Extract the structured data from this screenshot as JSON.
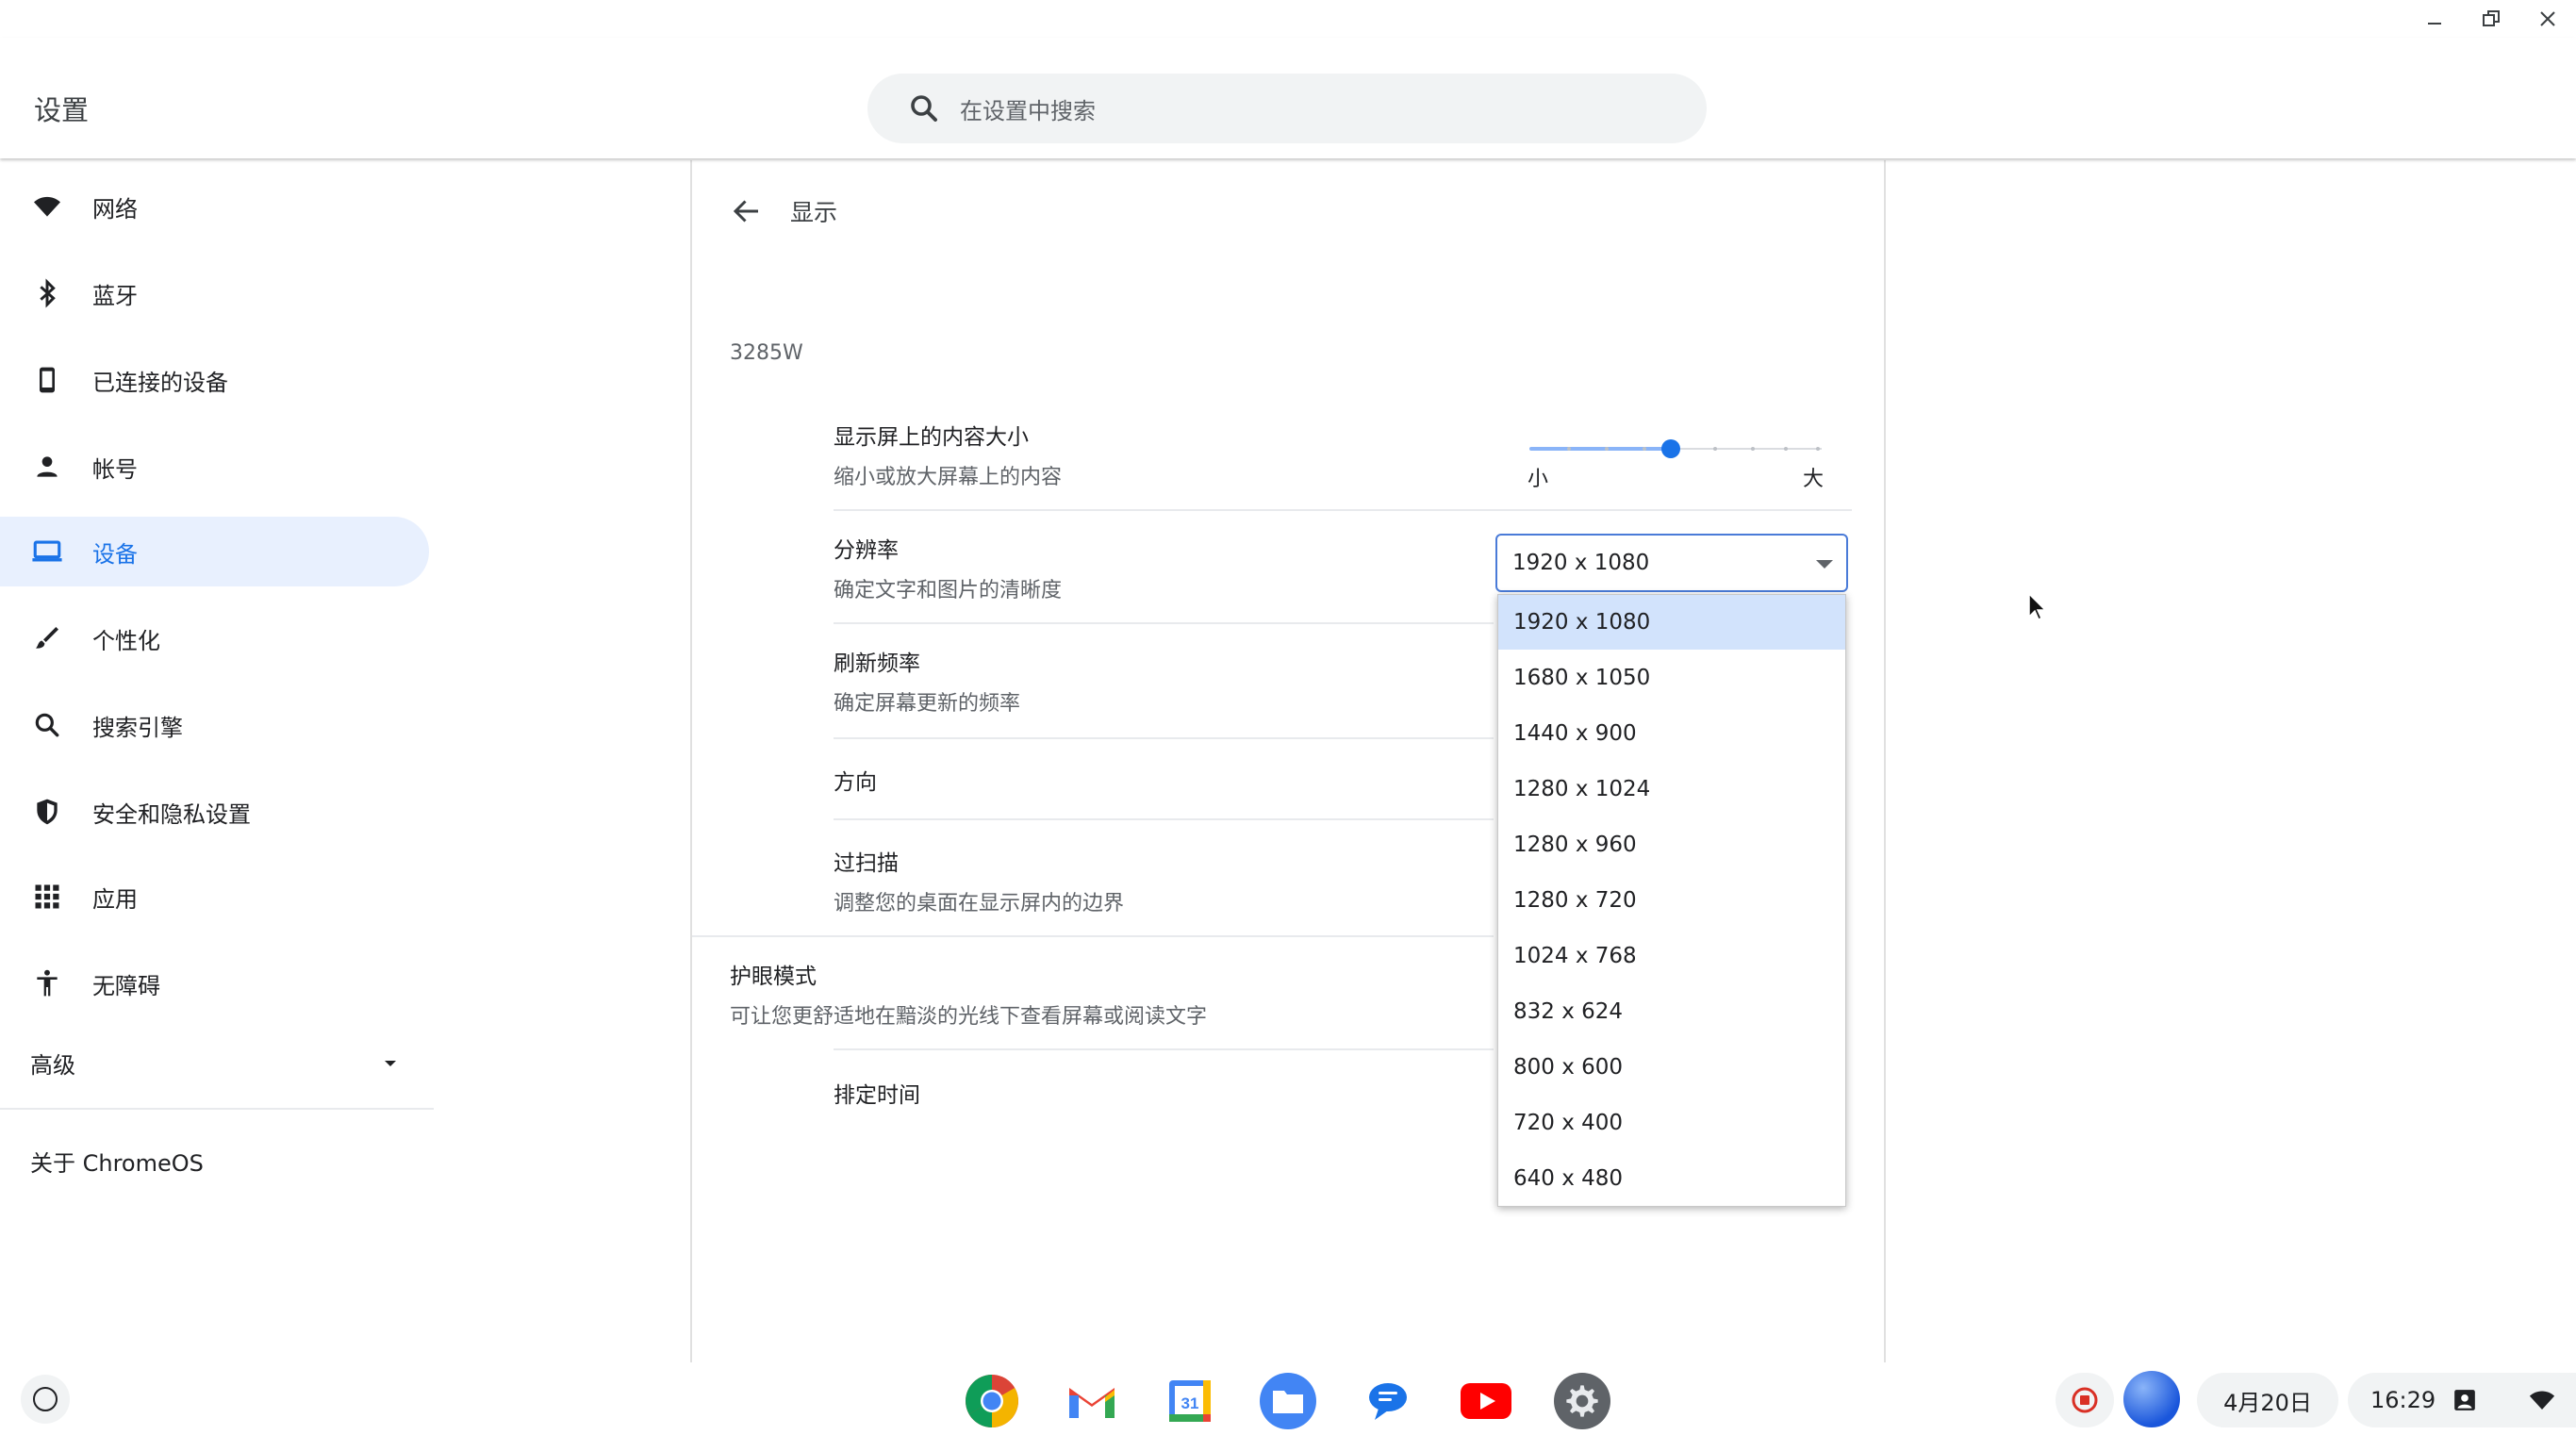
{
  "window": {
    "controls": [
      "minimize-icon",
      "restore-icon",
      "close-icon"
    ]
  },
  "header": {
    "title": "设置",
    "search_placeholder": "在设置中搜索"
  },
  "sidebar": {
    "items": [
      {
        "label": "网络",
        "icon": "wifi-icon"
      },
      {
        "label": "蓝牙",
        "icon": "bluetooth-icon"
      },
      {
        "label": "已连接的设备",
        "icon": "phone-icon"
      },
      {
        "label": "帐号",
        "icon": "person-icon"
      },
      {
        "label": "设备",
        "icon": "laptop-icon",
        "active": true
      },
      {
        "label": "个性化",
        "icon": "brush-icon"
      },
      {
        "label": "搜索引擎",
        "icon": "search-icon"
      },
      {
        "label": "安全和隐私设置",
        "icon": "shield-icon"
      },
      {
        "label": "应用",
        "icon": "apps-grid-icon"
      },
      {
        "label": "无障碍",
        "icon": "accessibility-icon"
      }
    ],
    "advanced": "高级",
    "about": "关于 ChromeOS"
  },
  "main": {
    "page_title": "显示",
    "display_name": "3285W",
    "rows": {
      "content_size": {
        "title": "显示屏上的内容大小",
        "subtitle": "缩小或放大屏幕上的内容",
        "min_label": "小",
        "max_label": "大",
        "slider_fraction": 0.45
      },
      "resolution": {
        "title": "分辨率",
        "subtitle": "确定文字和图片的清晰度",
        "value": "1920 x 1080"
      },
      "refresh": {
        "title": "刷新频率",
        "subtitle": "确定屏幕更新的频率"
      },
      "orientation": {
        "title": "方向"
      },
      "overscan": {
        "title": "过扫描",
        "subtitle": "调整您的桌面在显示屏内的边界"
      },
      "night_light": {
        "title": "护眼模式",
        "subtitle": "可让您更舒适地在黯淡的光线下查看屏幕或阅读文字"
      },
      "schedule": {
        "title": "排定时间"
      }
    },
    "resolution_options": [
      "1920 x 1080",
      "1680 x 1050",
      "1440 x 900",
      "1280 x 1024",
      "1280 x 960",
      "1280 x 720",
      "1024 x 768",
      "832 x 624",
      "800 x 600",
      "720 x 400",
      "640 x 480"
    ],
    "selected_option": "1920 x 1080"
  },
  "shelf": {
    "apps": [
      "chrome-icon",
      "gmail-icon",
      "calendar-icon",
      "files-icon",
      "messages-icon",
      "youtube-icon",
      "settings-icon"
    ],
    "calendar_day": "31",
    "date": "4月20日",
    "time": "16:29"
  },
  "colors": {
    "accent": "#1a73e8",
    "active_bg": "#e8f0fe",
    "selected_option_bg": "#d2e3fc"
  }
}
